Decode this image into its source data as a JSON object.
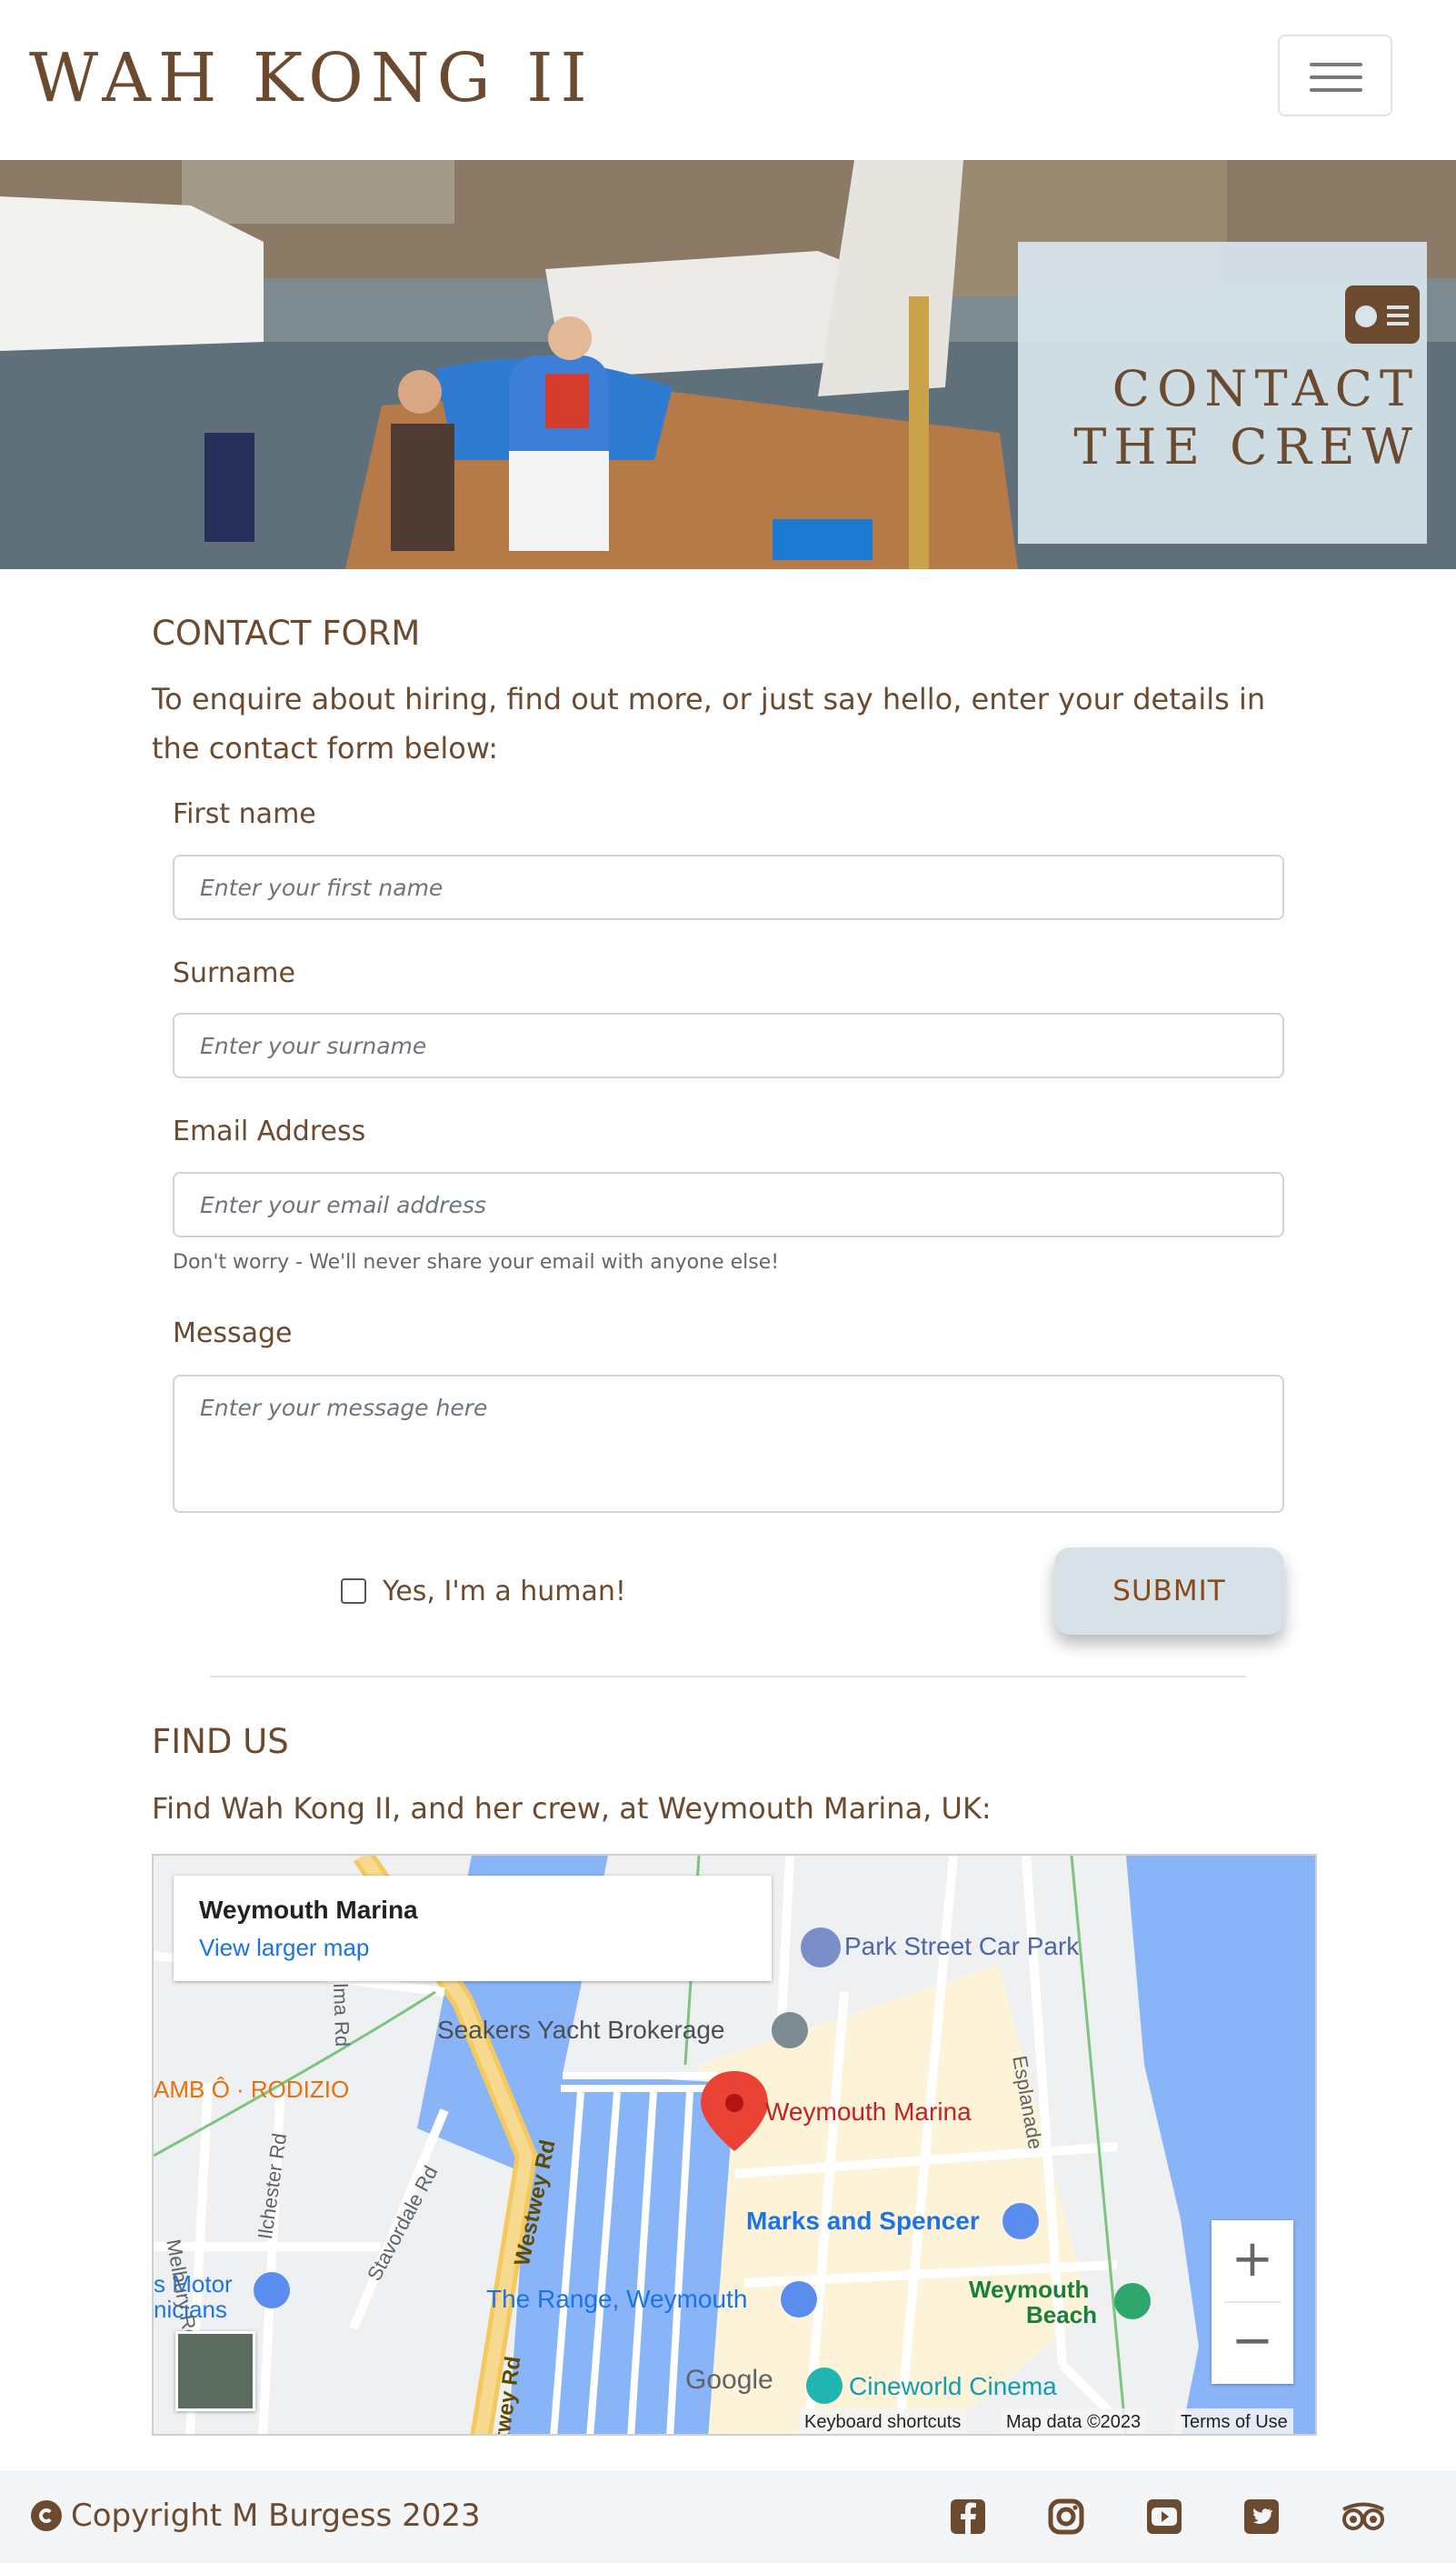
{
  "header": {
    "brand": "WAH KONG II",
    "menu_icon": "hamburger-menu-icon"
  },
  "hero": {
    "icon": "contact-card-icon",
    "title_line1": "CONTACT",
    "title_line2": "THE CREW"
  },
  "contact": {
    "heading": "CONTACT FORM",
    "intro": "To enquire about hiring, find out more, or just say hello, enter your details in the contact form below:",
    "first_name": {
      "label": "First name",
      "placeholder": "Enter your first name"
    },
    "surname": {
      "label": "Surname",
      "placeholder": "Enter your surname"
    },
    "email": {
      "label": "Email Address",
      "placeholder": "Enter your email address",
      "help": "Don't worry - We'll never share your email with anyone else!"
    },
    "message": {
      "label": "Message",
      "placeholder": "Enter your message here"
    },
    "human_label": "Yes, I'm a human!",
    "human_checked": false,
    "submit_label": "SUBMIT"
  },
  "find_us": {
    "heading": "FIND US",
    "intro": "Find Wah Kong II, and her crew, at Weymouth Marina, UK:",
    "map": {
      "card_title": "Weymouth Marina",
      "card_link": "View larger map",
      "labels": {
        "park": "Park Street Car Park",
        "seakers": "Seakers Yacht Brokerage",
        "marina": "Weymouth Marina",
        "rodizio": "AMB Ô · RODIZIO",
        "marks": "Marks and Spencer",
        "range": "The Range, Weymouth",
        "beach1": "Weymouth",
        "beach2": "Beach",
        "cineworld": "Cineworld Cinema",
        "motor1": "s Motor",
        "motor2": "nicians",
        "esplanade": "Esplanade",
        "westwey": "Westwey Rd",
        "westwey2": "twey Rd",
        "melbury": "Melbury Rd",
        "ilchester": "Ilchester Rd",
        "stavordale": "Stavordale Rd",
        "alma": "lma Rd",
        "google": "Google"
      },
      "zoom_in": "+",
      "zoom_out": "−",
      "keyboard": "Keyboard shortcuts",
      "mapdata": "Map data ©2023",
      "terms": "Terms of Use",
      "accent_pin": "#ea4335",
      "water": "#8ab4f8"
    }
  },
  "footer": {
    "copyright": "Copyright M Burgess 2023",
    "social": [
      "facebook-icon",
      "instagram-icon",
      "youtube-icon",
      "twitter-icon",
      "tripadvisor-icon"
    ]
  }
}
